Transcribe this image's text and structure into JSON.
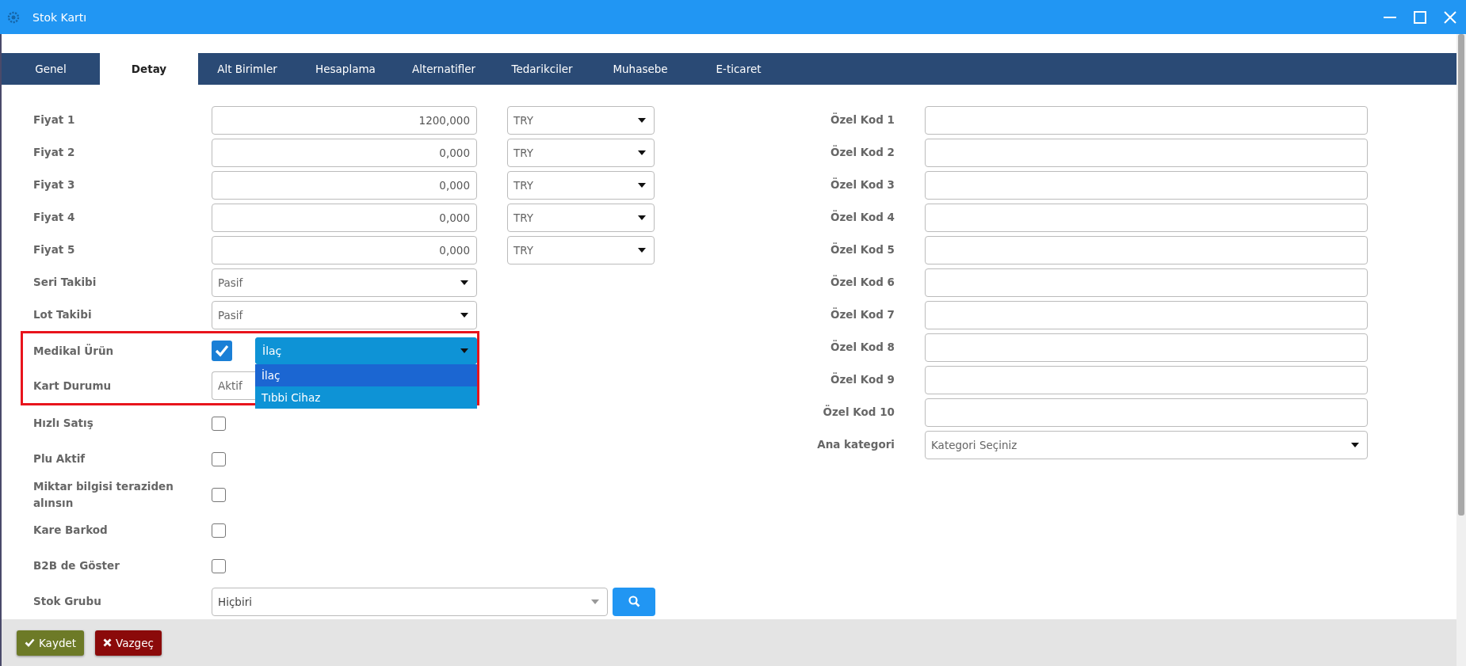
{
  "window": {
    "title": "Stok Kartı"
  },
  "tabs": [
    {
      "label": "Genel",
      "selected": false
    },
    {
      "label": "Detay",
      "selected": true
    },
    {
      "label": "Alt Birimler",
      "selected": false
    },
    {
      "label": "Hesaplama",
      "selected": false
    },
    {
      "label": "Alternatifler",
      "selected": false
    },
    {
      "label": "Tedarikciler",
      "selected": false
    },
    {
      "label": "Muhasebe",
      "selected": false
    },
    {
      "label": "E-ticaret",
      "selected": false
    }
  ],
  "left_fields": [
    {
      "kind": "price",
      "label": "Fiyat 1",
      "value": "1200,000",
      "currency": "TRY"
    },
    {
      "kind": "price",
      "label": "Fiyat 2",
      "value": "0,000",
      "currency": "TRY"
    },
    {
      "kind": "price",
      "label": "Fiyat 3",
      "value": "0,000",
      "currency": "TRY"
    },
    {
      "kind": "price",
      "label": "Fiyat 4",
      "value": "0,000",
      "currency": "TRY"
    },
    {
      "kind": "price",
      "label": "Fiyat 5",
      "value": "0,000",
      "currency": "TRY"
    },
    {
      "kind": "select",
      "label": "Seri Takibi",
      "value": "Pasif"
    },
    {
      "kind": "select",
      "label": "Lot Takibi",
      "value": "Pasif"
    },
    {
      "kind": "medical",
      "label": "Medikal Ürün",
      "checked": true,
      "highlighted": true,
      "select": {
        "value": "İlaç",
        "expanded": true,
        "options": [
          {
            "label": "İlaç",
            "selected": true
          },
          {
            "label": "Tıbbi Cihaz",
            "selected": false
          }
        ]
      }
    },
    {
      "kind": "select",
      "label": "Kart Durumu",
      "value": "Aktif",
      "highlighted": true
    },
    {
      "kind": "checkbox",
      "label": "Hızlı Satış",
      "checked": false
    },
    {
      "kind": "checkbox",
      "label": "Plu Aktif",
      "checked": false
    },
    {
      "kind": "checkbox",
      "label": "Miktar bilgisi teraziden alınsın",
      "checked": false
    },
    {
      "kind": "checkbox",
      "label": "Kare Barkod",
      "checked": false
    },
    {
      "kind": "checkbox",
      "label": "B2B de Göster",
      "checked": false
    },
    {
      "kind": "lookup",
      "label": "Stok Grubu",
      "value": "Hiçbiri"
    }
  ],
  "right_fields": [
    {
      "kind": "text",
      "label": "Özel Kod 1"
    },
    {
      "kind": "text",
      "label": "Özel Kod 2"
    },
    {
      "kind": "text",
      "label": "Özel Kod 3"
    },
    {
      "kind": "text",
      "label": "Özel Kod 4"
    },
    {
      "kind": "text",
      "label": "Özel Kod 5"
    },
    {
      "kind": "text",
      "label": "Özel Kod 6"
    },
    {
      "kind": "text",
      "label": "Özel Kod 7"
    },
    {
      "kind": "text",
      "label": "Özel Kod 8"
    },
    {
      "kind": "text",
      "label": "Özel Kod 9"
    },
    {
      "kind": "text",
      "label": "Özel Kod 10"
    },
    {
      "kind": "select",
      "label": "Ana kategori",
      "placeholder": "Kategori Seçiniz"
    }
  ],
  "buttons": [
    {
      "kind": "save",
      "label": "Kaydet"
    },
    {
      "kind": "cancel",
      "label": "Vazgeç"
    }
  ]
}
